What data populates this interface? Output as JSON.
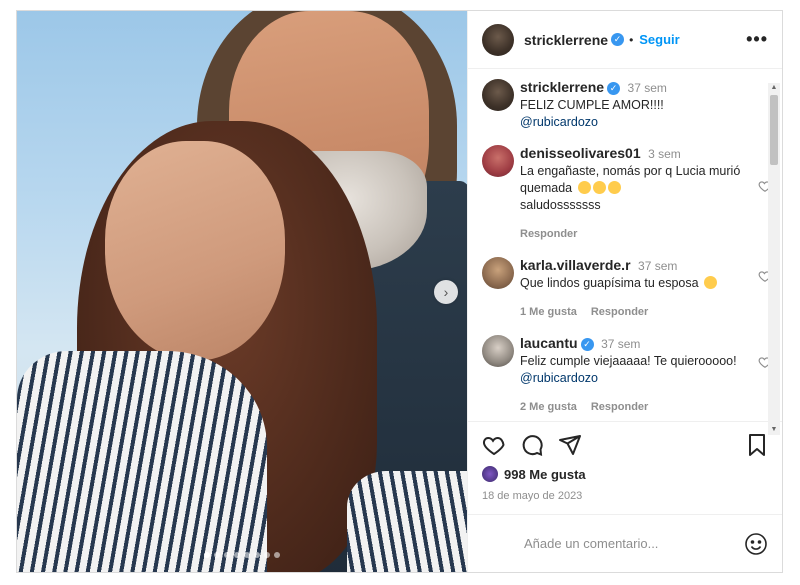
{
  "post": {
    "owner": "stricklerrene",
    "follow_label": "Seguir",
    "more_label": "•••",
    "separator": "•",
    "next_label": "›",
    "slide_count": 8,
    "active_slide": 1
  },
  "comments": [
    {
      "user": "stricklerrene",
      "verified": true,
      "time": "37 sem",
      "text": "FELIZ CUMPLE AMOR!!!!",
      "mention": "@rubicardozo",
      "likes_label": "",
      "reply_label": ""
    },
    {
      "user": "denisseolivares01",
      "verified": false,
      "time": "3 sem",
      "text": "La engañaste, nomás por q Lucia murió quemada",
      "emojis": [
        "frowning-emoji",
        "grinning-emoji",
        "grinning-emoji"
      ],
      "text_tail": "saludosssssss",
      "likes_label": "",
      "reply_label": "Responder"
    },
    {
      "user": "karla.villaverde.r",
      "verified": false,
      "time": "37 sem",
      "text": "Que lindos guapísima tu esposa",
      "emojis": [
        "kissing-emoji"
      ],
      "likes_label": "1 Me gusta",
      "reply_label": "Responder"
    },
    {
      "user": "laucantu",
      "verified": true,
      "time": "37 sem",
      "text": "Feliz cumple viejaaaaa! Te quierooooo!",
      "mention": "@rubicardozo",
      "likes_label": "2 Me gusta",
      "reply_label": "Responder"
    }
  ],
  "actions": {
    "likes_text": "998 Me gusta",
    "date": "18 de mayo de 2023"
  },
  "add_comment": {
    "placeholder": "Añade un comentario..."
  },
  "colors": {
    "link": "#0095f6",
    "verified": "#3897f0",
    "muted": "#8e8e8e",
    "text": "#262626"
  }
}
